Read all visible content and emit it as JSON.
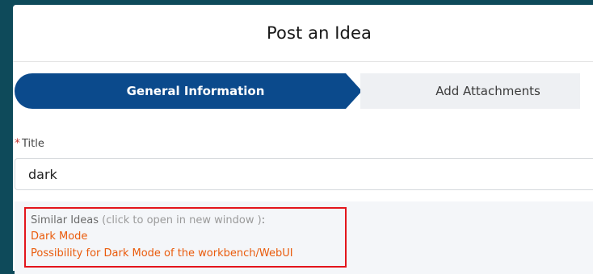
{
  "dialog": {
    "title": "Post an Idea"
  },
  "stepper": {
    "steps": [
      {
        "label": "General Information",
        "active": true
      },
      {
        "label": "Add Attachments",
        "active": false
      }
    ]
  },
  "form": {
    "title_field": {
      "required_mark": "*",
      "label": "Title",
      "value": "dark"
    }
  },
  "similar_ideas": {
    "heading": "Similar Ideas",
    "hint": "(click to open in new window )",
    "colon": ":",
    "items": [
      "Dark Mode",
      "Possibility for Dark Mode of the workbench/WebUI"
    ]
  },
  "colors": {
    "background": "#0e4a5a",
    "active_step": "#0b4a8c",
    "link": "#ea5b0c",
    "highlight_border": "#e3151c"
  }
}
